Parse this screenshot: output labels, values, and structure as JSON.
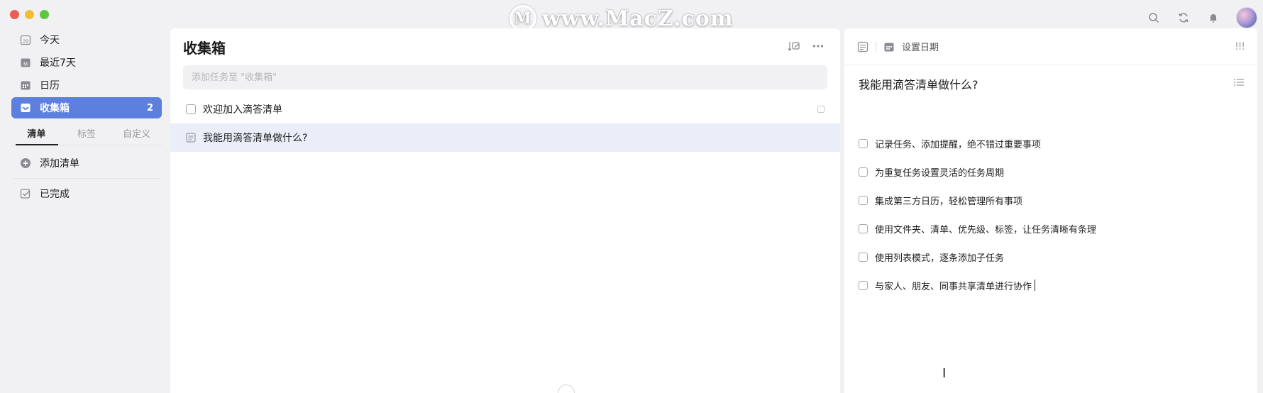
{
  "watermark": {
    "logo_glyph": "M",
    "text": "www.MacZ.com"
  },
  "sidebar": {
    "nav": [
      {
        "label": "今天",
        "icon": "calendar-today-icon",
        "date_glyph": "29"
      },
      {
        "label": "最近7天",
        "icon": "calendar-week-icon",
        "date_glyph": "M"
      },
      {
        "label": "日历",
        "icon": "calendar-icon"
      },
      {
        "label": "收集箱",
        "icon": "inbox-icon",
        "count": "2",
        "active": true
      }
    ],
    "tabs": [
      "清单",
      "标签",
      "自定义"
    ],
    "active_tab": "清单",
    "add_list_label": "添加清单",
    "completed_label": "已完成"
  },
  "middle": {
    "title": "收集箱",
    "add_task_placeholder": "添加任务至 \"收集箱\"",
    "tasks": [
      {
        "title": "欢迎加入滴答清单",
        "type": "checkbox",
        "selected": false
      },
      {
        "title": "我能用滴答清单做什么?",
        "type": "note",
        "selected": true
      }
    ]
  },
  "detail": {
    "date_label": "设置日期",
    "priority_label": "!!!",
    "title": "我能用滴答清单做什么?",
    "checklist": [
      "记录任务、添加提醒，绝不错过重要事项",
      "为重复任务设置灵活的任务周期",
      "集成第三方日历，轻松管理所有事项",
      "使用文件夹、清单、优先级、标签，让任务清晰有条理",
      "使用列表模式，逐条添加子任务",
      "与家人、朋友、同事共享清单进行协作"
    ]
  },
  "colors": {
    "accent": "#5d7fdd",
    "selected_row": "#eaeef9",
    "window_bg": "#f1f1f4"
  }
}
